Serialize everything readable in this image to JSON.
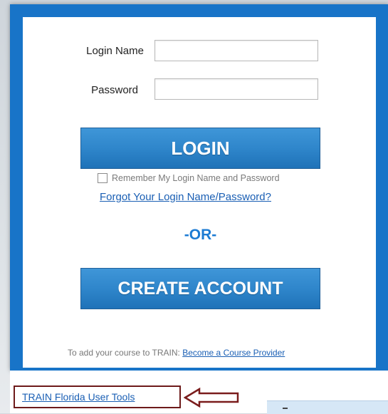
{
  "login_form": {
    "login_name_label": "Login Name",
    "login_name_value": "",
    "password_label": "Password",
    "password_value": "",
    "login_button_label": "LOGIN",
    "remember_label": "Remember My Login Name and Password",
    "remember_checked": false,
    "forgot_link": "Forgot Your Login Name/Password?",
    "or_divider": "-OR-",
    "create_account_label": "CREATE ACCOUNT"
  },
  "provider": {
    "prefix": "To add your course to TRAIN:",
    "link": "Become a Course Provider"
  },
  "footer": {
    "user_tools_link": "TRAIN Florida User Tools",
    "arrow_icon": "left-arrow-icon"
  },
  "colors": {
    "frame_blue": "#1874c8",
    "button_blue": "#2f86cb",
    "link_blue": "#1a5fb4",
    "or_blue": "#1c7bd3",
    "highlight_box": "#6d1a1a"
  }
}
